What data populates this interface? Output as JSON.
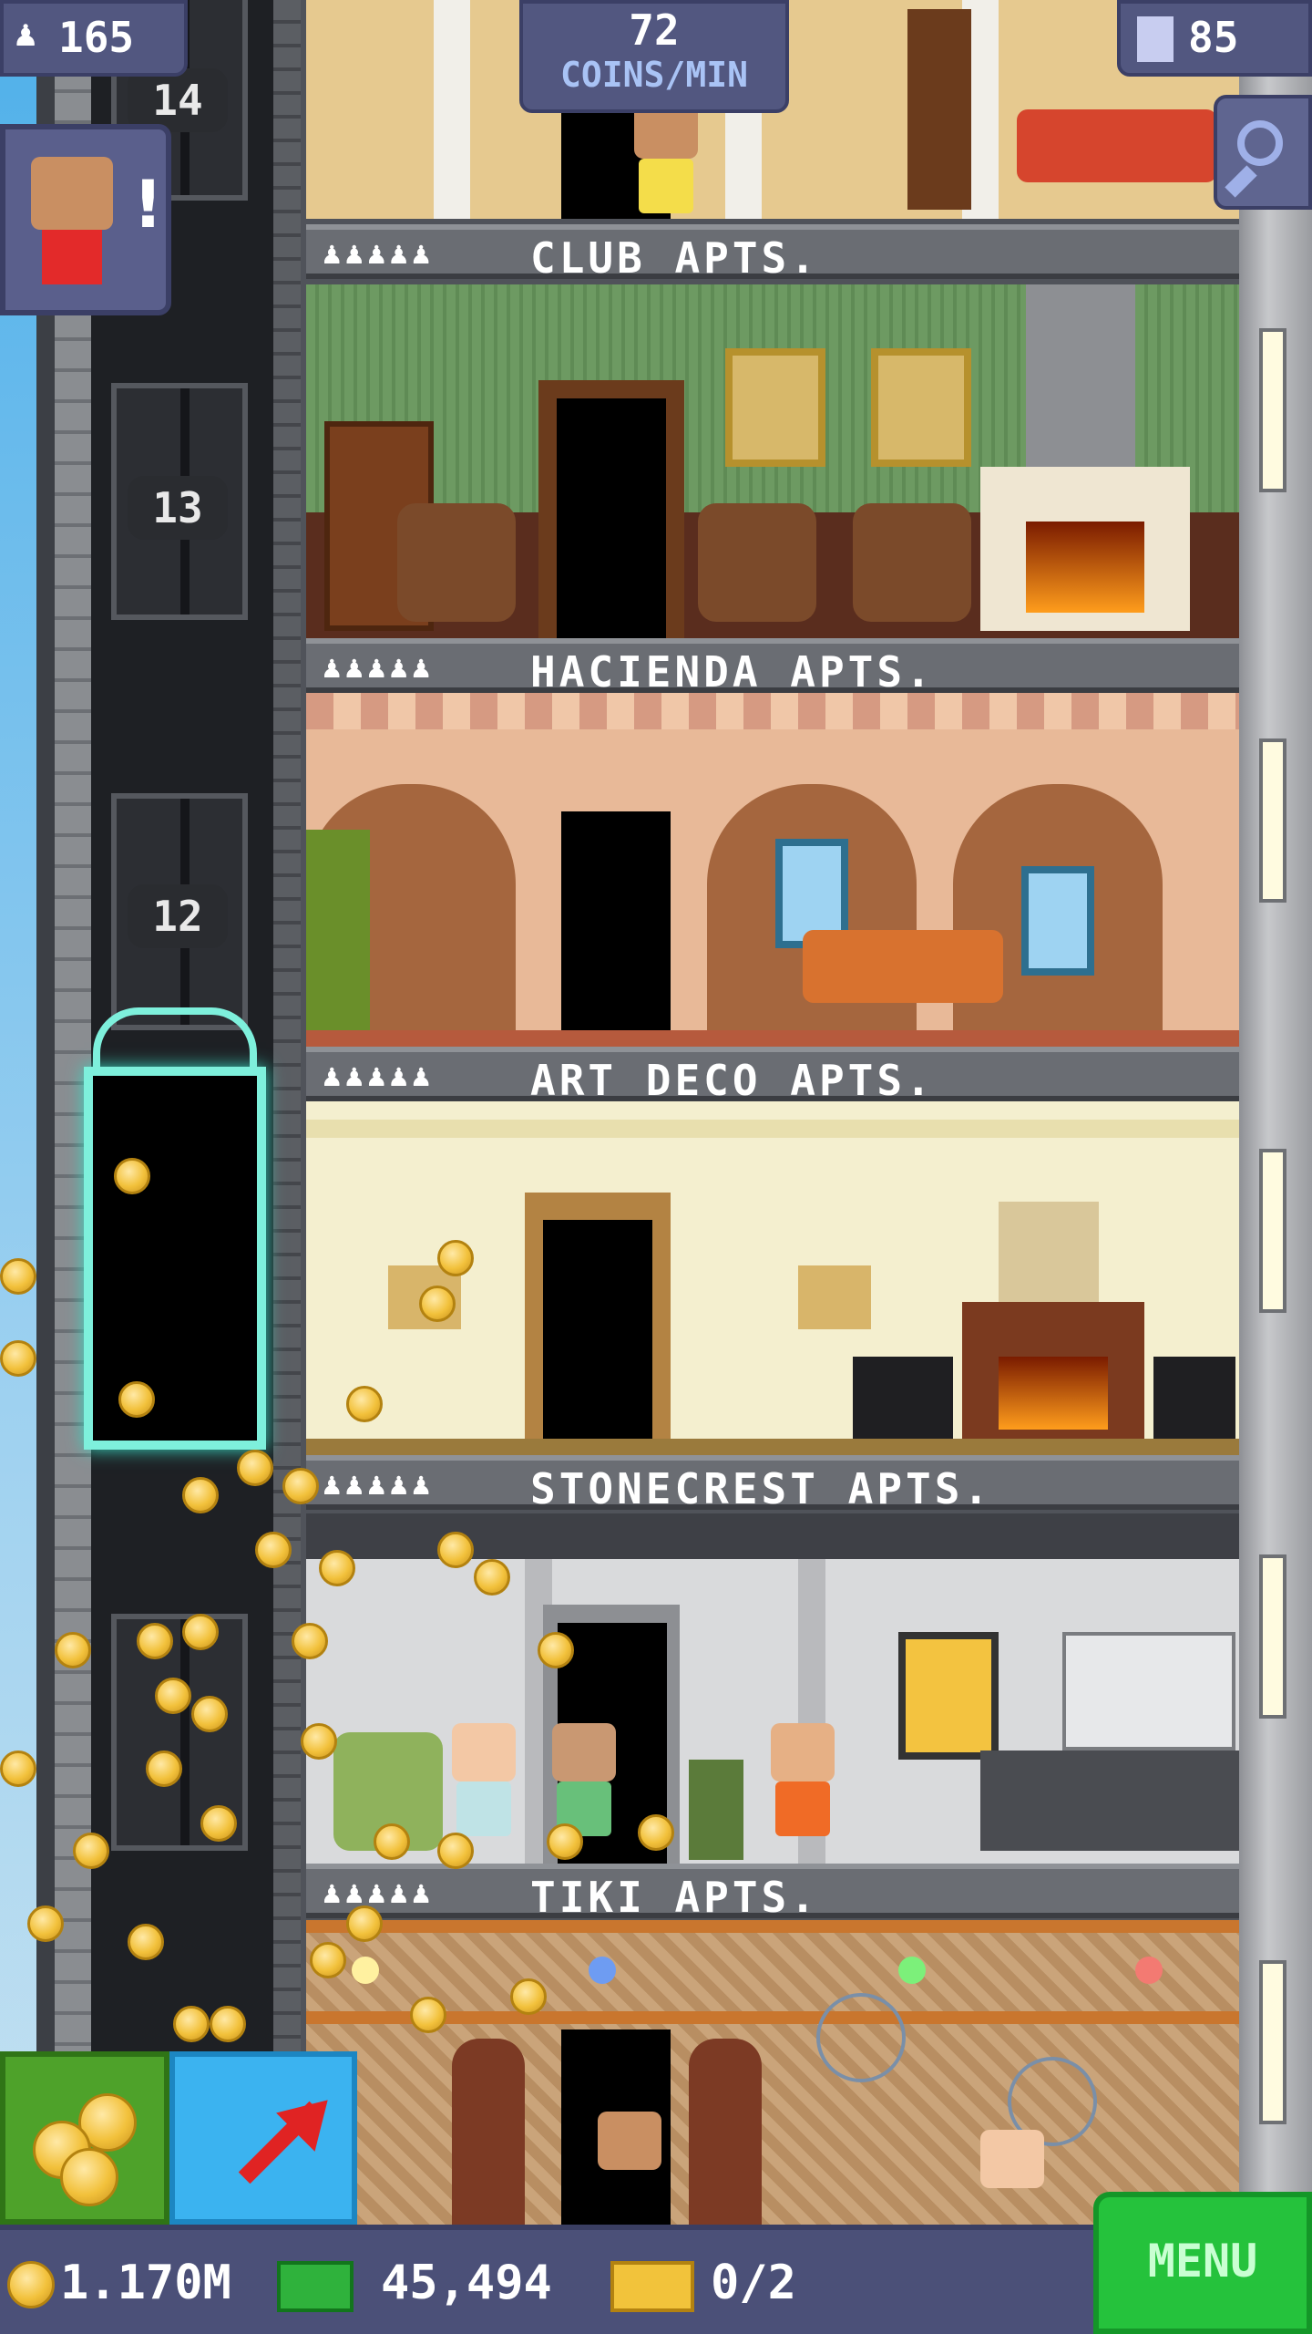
{
  "hud": {
    "population": "165",
    "coins_rate_value": "72",
    "coins_rate_unit": "COINS/MIN",
    "floors": "85"
  },
  "shaft_floor_numbers": [
    "14",
    "13",
    "12"
  ],
  "floors": [
    {
      "name": "CLUB APTS.",
      "people": "♟♟♟♟♟"
    },
    {
      "name": "HACIENDA APTS.",
      "people": "♟♟♟♟♟"
    },
    {
      "name": "ART DECO APTS.",
      "people": "♟♟♟♟♟"
    },
    {
      "name": "STONECREST APTS.",
      "people": "♟♟♟♟♟"
    },
    {
      "name": "TIKI APTS.",
      "people": "♟♟♟♟♟"
    }
  ],
  "bottom": {
    "coins": "1.170M",
    "bux": "45,494",
    "tickets": "0/2",
    "menu": "MENU"
  },
  "notification": "!",
  "colors": {
    "hud_bg": "#525780",
    "menu_green": "#25c23c",
    "coin_gold": "#f2c13b",
    "label_bar": "#6a6d73"
  }
}
